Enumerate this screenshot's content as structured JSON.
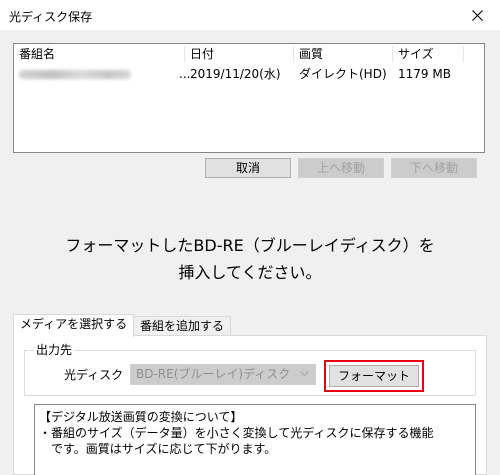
{
  "window": {
    "title": "光ディスク保存"
  },
  "program_list": {
    "columns": [
      "番組名",
      "日付",
      "画質",
      "サイズ"
    ],
    "rows": [
      {
        "name_ellipsis": "...",
        "date": "2019/11/20(水)",
        "quality": "ダイレクト(HD)",
        "size": "1179 MB"
      }
    ]
  },
  "list_buttons": {
    "cancel": "取消",
    "move_up": "上へ移動",
    "move_down": "下へ移動"
  },
  "message": {
    "line1": "フォーマットしたBD-RE（ブルーレイディスク）を",
    "line2": "挿入してください。"
  },
  "tabs": [
    {
      "label": "メディアを選択する",
      "active": true
    },
    {
      "label": "番組を追加する",
      "active": false
    }
  ],
  "output": {
    "group_title": "出力先",
    "disc_label": "光ディスク",
    "disc_value": "BD-RE(ブルーレイ)ディスク",
    "format_button": "フォーマット",
    "highlight_color": "#e60012"
  },
  "info": {
    "heading": "【デジタル放送画質の変換について】",
    "line1": "・番組のサイズ（データ量）を小さく変換して光ディスクに保存する機能",
    "line2": "　です。画質はサイズに応じて下がります。"
  }
}
